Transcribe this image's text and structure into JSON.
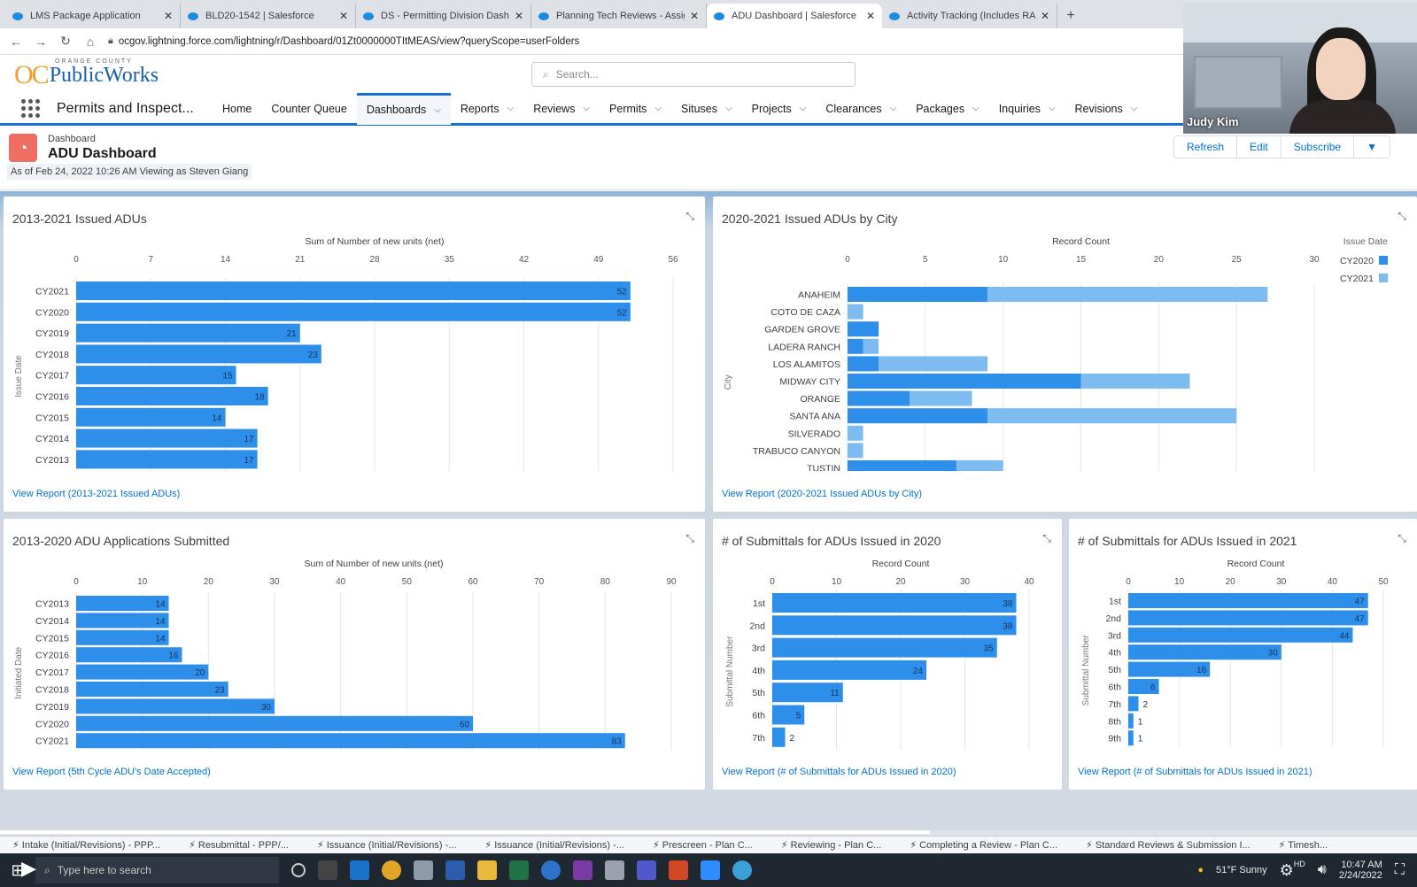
{
  "browser": {
    "tabs": [
      {
        "title": "LMS Package Application",
        "active": false
      },
      {
        "title": "BLD20-1542 | Salesforce",
        "active": false
      },
      {
        "title": "DS - Permitting Division Dashbo",
        "active": false
      },
      {
        "title": "Planning Tech Reviews - Assigne",
        "active": false
      },
      {
        "title": "ADU Dashboard | Salesforce",
        "active": true
      },
      {
        "title": "Activity Tracking (Includes RA) | S",
        "active": false
      }
    ],
    "new_tab": "+",
    "url": "ocgov.lightning.force.com/lightning/r/Dashboard/01Zt0000000TItMEAS/view?queryScope=userFolders"
  },
  "header": {
    "logo_small": "ORANGE COUNTY",
    "logo_oc": "OC",
    "logo_name": "PublicWorks",
    "search_placeholder": "Search..."
  },
  "appnav": {
    "app_name": "Permits and Inspect...",
    "items": [
      {
        "label": "Home",
        "dropdown": false
      },
      {
        "label": "Counter Queue",
        "dropdown": false
      },
      {
        "label": "Dashboards",
        "dropdown": true,
        "active": true
      },
      {
        "label": "Reports",
        "dropdown": true
      },
      {
        "label": "Reviews",
        "dropdown": true
      },
      {
        "label": "Permits",
        "dropdown": true
      },
      {
        "label": "Situses",
        "dropdown": true
      },
      {
        "label": "Projects",
        "dropdown": true
      },
      {
        "label": "Clearances",
        "dropdown": true
      },
      {
        "label": "Packages",
        "dropdown": true
      },
      {
        "label": "Inquiries",
        "dropdown": true
      },
      {
        "label": "Revisions",
        "dropdown": true
      }
    ]
  },
  "webcam": {
    "name": "Judy Kim"
  },
  "page": {
    "kicker": "Dashboard",
    "title": "ADU Dashboard",
    "as_of": "As of Feb 24, 2022 10:26 AM Viewing as Steven Giang",
    "buttons": [
      "Refresh",
      "Edit",
      "Subscribe"
    ]
  },
  "colors": {
    "bar_primary": "#2e8fea",
    "bar_secondary": "#7cbcf0",
    "link": "#0070d2"
  },
  "chart_data": [
    {
      "id": "issued",
      "type": "bar",
      "title": "2013-2021 Issued ADUs",
      "xlabel": "Sum of Number of new units (net)",
      "ylabel": "Issue Date",
      "xticks": [
        0,
        7,
        14,
        21,
        28,
        35,
        42,
        49,
        56
      ],
      "xlim": [
        0,
        56
      ],
      "categories": [
        "CY2021",
        "CY2020",
        "CY2019",
        "CY2018",
        "CY2017",
        "CY2016",
        "CY2015",
        "CY2014",
        "CY2013"
      ],
      "values": [
        52,
        52,
        21,
        23,
        15,
        18,
        14,
        17,
        17
      ],
      "link": "View Report (2013-2021 Issued ADUs)"
    },
    {
      "id": "bycity",
      "type": "bar",
      "stacked": true,
      "title": "2020-2021 Issued ADUs by City",
      "xlabel": "Record Count",
      "ylabel": "City",
      "xticks": [
        0,
        5,
        10,
        15,
        20,
        25,
        30
      ],
      "xlim": [
        0,
        30
      ],
      "categories": [
        "ANAHEIM",
        "COTO DE CAZA",
        "GARDEN GROVE",
        "LADERA RANCH",
        "LOS ALAMITOS",
        "MIDWAY CITY",
        "ORANGE",
        "SANTA ANA",
        "SILVERADO",
        "TRABUCO CANYON",
        "TUSTIN"
      ],
      "series": [
        {
          "name": "CY2020",
          "values": [
            9,
            0,
            2,
            1,
            2,
            15,
            4,
            9,
            0,
            0,
            7
          ]
        },
        {
          "name": "CY2021",
          "values": [
            18,
            1,
            0,
            1,
            7,
            7,
            4,
            16,
            1,
            1,
            3
          ]
        }
      ],
      "legend_title": "Issue Date",
      "legend_position": "top-right",
      "link": "View Report (2020-2021 Issued ADUs by City)"
    },
    {
      "id": "submitted",
      "type": "bar",
      "title": "2013-2020 ADU Applications Submitted",
      "xlabel": "Sum of Number of new units (net)",
      "ylabel": "Initiated Date",
      "xticks": [
        0,
        10,
        20,
        30,
        40,
        50,
        60,
        70,
        80,
        90
      ],
      "xlim": [
        0,
        90
      ],
      "categories": [
        "CY2013",
        "CY2014",
        "CY2015",
        "CY2016",
        "CY2017",
        "CY2018",
        "CY2019",
        "CY2020",
        "CY2021"
      ],
      "values": [
        14,
        14,
        14,
        16,
        20,
        23,
        30,
        60,
        83
      ],
      "link": "View Report (5th Cycle ADU's Date Accepted)"
    },
    {
      "id": "sub2020",
      "type": "bar",
      "title": "# of Submittals for ADUs Issued in 2020",
      "xlabel": "Record Count",
      "ylabel": "Submittal Number",
      "xticks": [
        0,
        10,
        20,
        30,
        40
      ],
      "xlim": [
        0,
        40
      ],
      "categories": [
        "1st",
        "2nd",
        "3rd",
        "4th",
        "5th",
        "6th",
        "7th"
      ],
      "values": [
        38,
        38,
        35,
        24,
        11,
        5,
        2
      ],
      "link": "View Report (# of Submittals for ADUs Issued in 2020)"
    },
    {
      "id": "sub2021",
      "type": "bar",
      "title": "# of Submittals for ADUs Issued in 2021",
      "xlabel": "Record Count",
      "ylabel": "Submittal Number",
      "xticks": [
        0,
        10,
        20,
        30,
        40,
        50
      ],
      "xlim": [
        0,
        50
      ],
      "categories": [
        "1st",
        "2nd",
        "3rd",
        "4th",
        "5th",
        "6th",
        "7th",
        "8th",
        "9th"
      ],
      "values": [
        47,
        47,
        44,
        30,
        16,
        6,
        2,
        1,
        1
      ],
      "link": "View Report (# of Submittals for ADUs Issued in 2021)"
    }
  ],
  "utility_bar": [
    "Intake (Initial/Revisions) - PPP...",
    "Resubmittal - PPP/...",
    "Issuance (Initial/Revisions) -...",
    "Issuance (Initial/Revisions) -...",
    "Prescreen - Plan C...",
    "Reviewing - Plan C...",
    "Completing a Review - Plan C...",
    "Standard Reviews & Submission I...",
    "Timesh..."
  ],
  "taskbar": {
    "search_placeholder": "Type here to search",
    "weather": "51°F  Sunny",
    "time": "10:47 AM",
    "date": "2/24/2022",
    "hd": "HD"
  }
}
